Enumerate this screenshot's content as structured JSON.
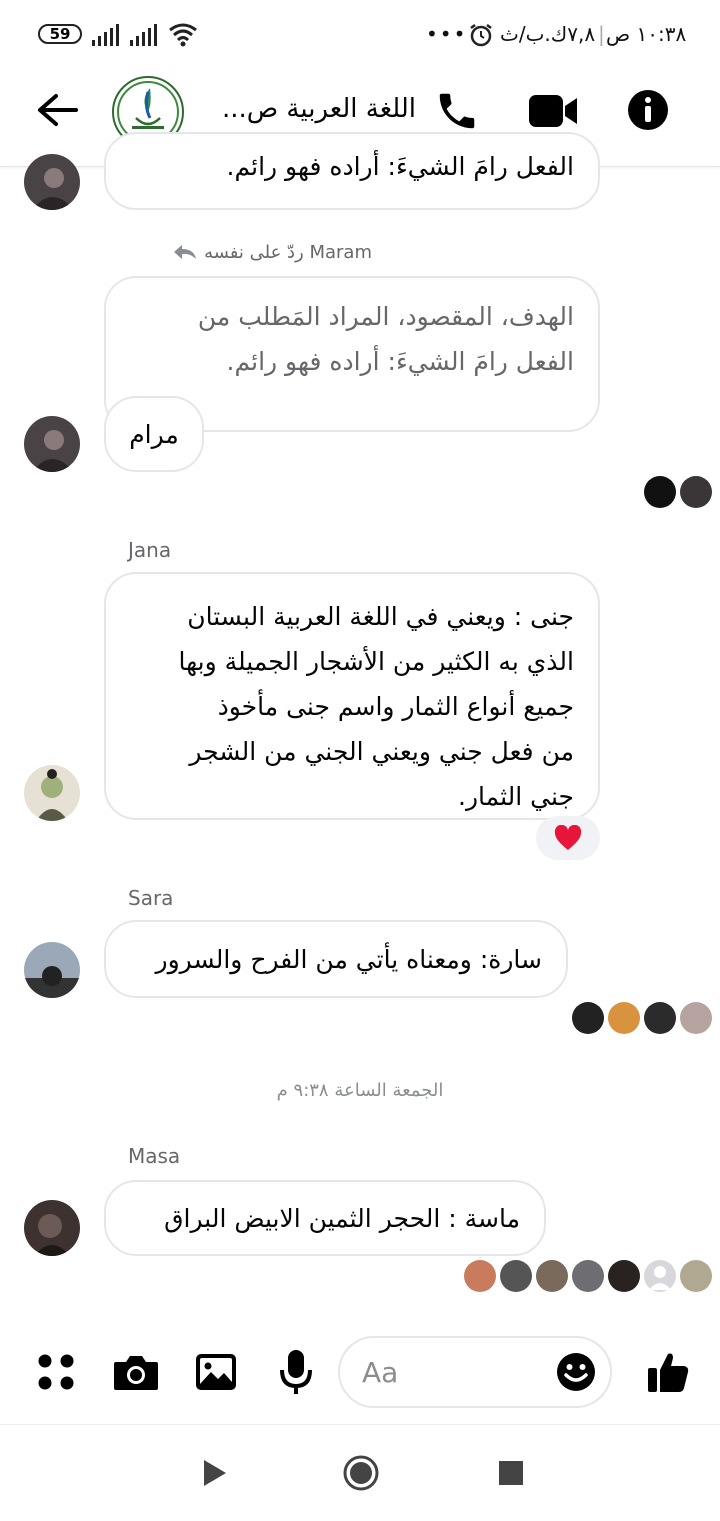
{
  "status_bar": {
    "battery": "59",
    "time": "١٠:٣٨ ص",
    "date": "٧,٨ك.ب/ث",
    "dots": "•••"
  },
  "header": {
    "title": "اللغة العربية ص..."
  },
  "messages": {
    "partial_top": "الفعل رامَ الشيءَ: أراده فهو رائم.",
    "reply_label": "Maram ردّ على نفسه",
    "reply_line1": "الهدف، المقصود، المراد المَطلب من",
    "reply_line2": "الفعل رامَ الشيءَ: أراده فهو رائم.",
    "maram_text": "مرام",
    "jana_sender": "Jana",
    "jana_lines": [
      "جنى : ويعني في اللغة العربية البستان",
      "الذي به الكثير من الأشجار الجميلة وبها",
      "جميع أنواع الثمار  واسم جنى مأخوذ",
      "من فعل جني ويعني الجني من الشجر",
      "جني الثمار."
    ],
    "jana_reaction": "❤️",
    "sara_sender": "Sara",
    "sara_text": "سارة:  ومعناه يأتي من الفرح والسرور",
    "timestamp": "الجمعة الساعة ٩:٣٨ م",
    "masa_sender": "Masa",
    "masa_text": "ماسة : الحجر الثمين الابيض البراق"
  },
  "composer": {
    "placeholder": "Aa"
  },
  "icons": {
    "back": "back-arrow-icon",
    "call": "phone-icon",
    "video": "video-camera-icon",
    "info": "info-icon",
    "menu": "four-dots-icon",
    "camera": "camera-icon",
    "gallery": "image-icon",
    "mic": "microphone-icon",
    "emoji": "emoji-icon",
    "like": "thumbs-up-icon"
  },
  "colors": {
    "accent": "#000000",
    "bubble_border": "#e4e6eb",
    "heart": "#e8153a"
  }
}
